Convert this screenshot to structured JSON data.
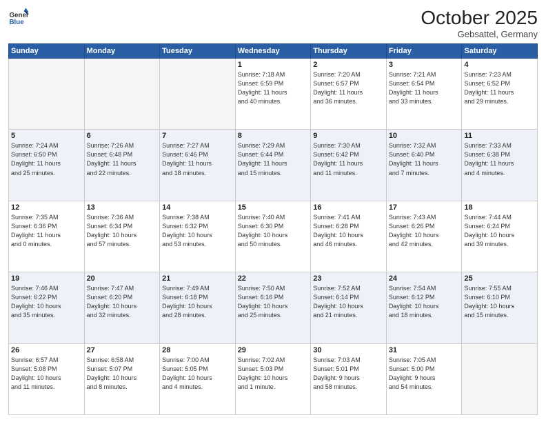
{
  "header": {
    "logo_general": "General",
    "logo_blue": "Blue",
    "month": "October 2025",
    "location": "Gebsattel, Germany"
  },
  "weekdays": [
    "Sunday",
    "Monday",
    "Tuesday",
    "Wednesday",
    "Thursday",
    "Friday",
    "Saturday"
  ],
  "weeks": [
    [
      {
        "day": "",
        "info": ""
      },
      {
        "day": "",
        "info": ""
      },
      {
        "day": "",
        "info": ""
      },
      {
        "day": "1",
        "info": "Sunrise: 7:18 AM\nSunset: 6:59 PM\nDaylight: 11 hours\nand 40 minutes."
      },
      {
        "day": "2",
        "info": "Sunrise: 7:20 AM\nSunset: 6:57 PM\nDaylight: 11 hours\nand 36 minutes."
      },
      {
        "day": "3",
        "info": "Sunrise: 7:21 AM\nSunset: 6:54 PM\nDaylight: 11 hours\nand 33 minutes."
      },
      {
        "day": "4",
        "info": "Sunrise: 7:23 AM\nSunset: 6:52 PM\nDaylight: 11 hours\nand 29 minutes."
      }
    ],
    [
      {
        "day": "5",
        "info": "Sunrise: 7:24 AM\nSunset: 6:50 PM\nDaylight: 11 hours\nand 25 minutes."
      },
      {
        "day": "6",
        "info": "Sunrise: 7:26 AM\nSunset: 6:48 PM\nDaylight: 11 hours\nand 22 minutes."
      },
      {
        "day": "7",
        "info": "Sunrise: 7:27 AM\nSunset: 6:46 PM\nDaylight: 11 hours\nand 18 minutes."
      },
      {
        "day": "8",
        "info": "Sunrise: 7:29 AM\nSunset: 6:44 PM\nDaylight: 11 hours\nand 15 minutes."
      },
      {
        "day": "9",
        "info": "Sunrise: 7:30 AM\nSunset: 6:42 PM\nDaylight: 11 hours\nand 11 minutes."
      },
      {
        "day": "10",
        "info": "Sunrise: 7:32 AM\nSunset: 6:40 PM\nDaylight: 11 hours\nand 7 minutes."
      },
      {
        "day": "11",
        "info": "Sunrise: 7:33 AM\nSunset: 6:38 PM\nDaylight: 11 hours\nand 4 minutes."
      }
    ],
    [
      {
        "day": "12",
        "info": "Sunrise: 7:35 AM\nSunset: 6:36 PM\nDaylight: 11 hours\nand 0 minutes."
      },
      {
        "day": "13",
        "info": "Sunrise: 7:36 AM\nSunset: 6:34 PM\nDaylight: 10 hours\nand 57 minutes."
      },
      {
        "day": "14",
        "info": "Sunrise: 7:38 AM\nSunset: 6:32 PM\nDaylight: 10 hours\nand 53 minutes."
      },
      {
        "day": "15",
        "info": "Sunrise: 7:40 AM\nSunset: 6:30 PM\nDaylight: 10 hours\nand 50 minutes."
      },
      {
        "day": "16",
        "info": "Sunrise: 7:41 AM\nSunset: 6:28 PM\nDaylight: 10 hours\nand 46 minutes."
      },
      {
        "day": "17",
        "info": "Sunrise: 7:43 AM\nSunset: 6:26 PM\nDaylight: 10 hours\nand 42 minutes."
      },
      {
        "day": "18",
        "info": "Sunrise: 7:44 AM\nSunset: 6:24 PM\nDaylight: 10 hours\nand 39 minutes."
      }
    ],
    [
      {
        "day": "19",
        "info": "Sunrise: 7:46 AM\nSunset: 6:22 PM\nDaylight: 10 hours\nand 35 minutes."
      },
      {
        "day": "20",
        "info": "Sunrise: 7:47 AM\nSunset: 6:20 PM\nDaylight: 10 hours\nand 32 minutes."
      },
      {
        "day": "21",
        "info": "Sunrise: 7:49 AM\nSunset: 6:18 PM\nDaylight: 10 hours\nand 28 minutes."
      },
      {
        "day": "22",
        "info": "Sunrise: 7:50 AM\nSunset: 6:16 PM\nDaylight: 10 hours\nand 25 minutes."
      },
      {
        "day": "23",
        "info": "Sunrise: 7:52 AM\nSunset: 6:14 PM\nDaylight: 10 hours\nand 21 minutes."
      },
      {
        "day": "24",
        "info": "Sunrise: 7:54 AM\nSunset: 6:12 PM\nDaylight: 10 hours\nand 18 minutes."
      },
      {
        "day": "25",
        "info": "Sunrise: 7:55 AM\nSunset: 6:10 PM\nDaylight: 10 hours\nand 15 minutes."
      }
    ],
    [
      {
        "day": "26",
        "info": "Sunrise: 6:57 AM\nSunset: 5:08 PM\nDaylight: 10 hours\nand 11 minutes."
      },
      {
        "day": "27",
        "info": "Sunrise: 6:58 AM\nSunset: 5:07 PM\nDaylight: 10 hours\nand 8 minutes."
      },
      {
        "day": "28",
        "info": "Sunrise: 7:00 AM\nSunset: 5:05 PM\nDaylight: 10 hours\nand 4 minutes."
      },
      {
        "day": "29",
        "info": "Sunrise: 7:02 AM\nSunset: 5:03 PM\nDaylight: 10 hours\nand 1 minute."
      },
      {
        "day": "30",
        "info": "Sunrise: 7:03 AM\nSunset: 5:01 PM\nDaylight: 9 hours\nand 58 minutes."
      },
      {
        "day": "31",
        "info": "Sunrise: 7:05 AM\nSunset: 5:00 PM\nDaylight: 9 hours\nand 54 minutes."
      },
      {
        "day": "",
        "info": ""
      }
    ]
  ]
}
